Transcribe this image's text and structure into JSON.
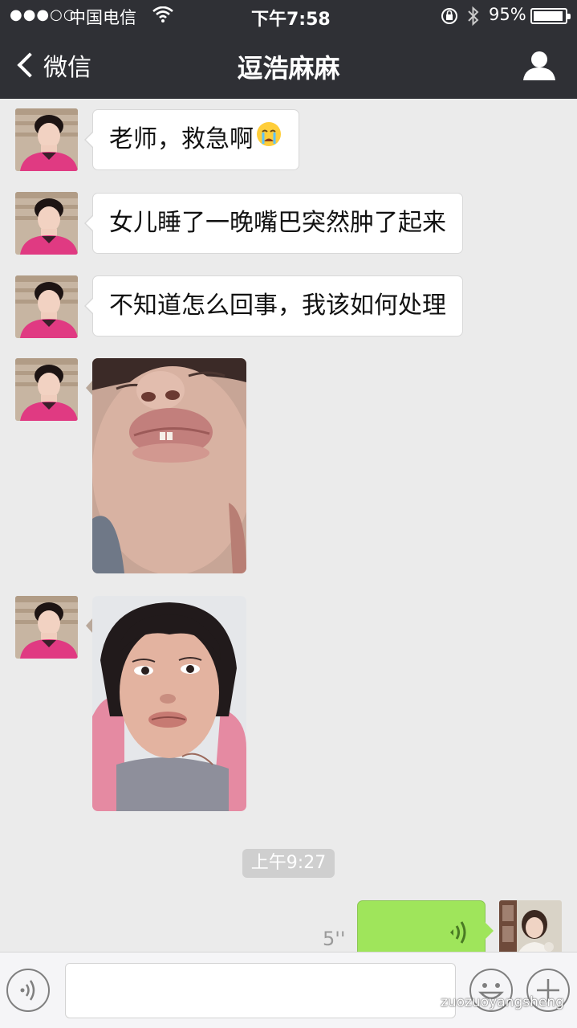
{
  "status_bar": {
    "signal_dots": "●●●○○",
    "carrier": "中国电信",
    "time": "下午7:58",
    "battery": "95%",
    "battery_level": 0.95
  },
  "nav": {
    "back_label": "微信",
    "title": "逗浩麻麻"
  },
  "messages": [
    {
      "type": "text",
      "text": "老师，救急啊",
      "emoji": "crying-face"
    },
    {
      "type": "text",
      "text": "女儿睡了一晚嘴巴突然肿了起来"
    },
    {
      "type": "text",
      "text": "不知道怎么回事，我该如何处理"
    },
    {
      "type": "image",
      "description_icon": "photo"
    },
    {
      "type": "image",
      "description_icon": "photo"
    }
  ],
  "timestamp": "上午9:27",
  "voice_message": {
    "duration": "5''"
  },
  "watermark": "zuozuoyangsheng",
  "colors": {
    "header_bg": "#2f3035",
    "chat_bg": "#ebebeb",
    "sent_bubble": "#9fe55b",
    "received_bubble": "#ffffff"
  }
}
